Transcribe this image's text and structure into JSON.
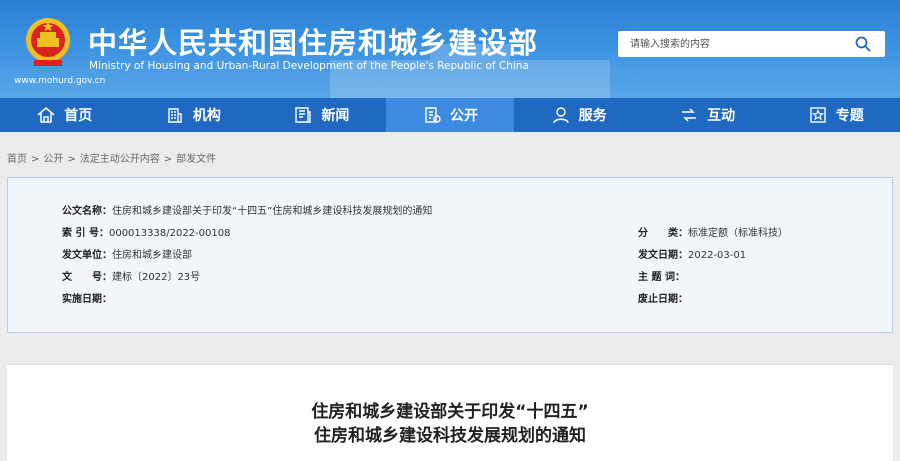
{
  "header": {
    "title": "中华人民共和国住房和城乡建设部",
    "subtitle": "Ministry of Housing and Urban-Rural Development of the People's Republic of China",
    "site_url": "www.mohurd.gov.cn",
    "search_placeholder": "请输入搜索的内容",
    "search_icon": "search-icon"
  },
  "nav": [
    {
      "label": "首页",
      "icon": "home-icon"
    },
    {
      "label": "机构",
      "icon": "building-icon"
    },
    {
      "label": "新闻",
      "icon": "news-icon"
    },
    {
      "label": "公开",
      "icon": "disclosure-icon"
    },
    {
      "label": "服务",
      "icon": "service-icon"
    },
    {
      "label": "互动",
      "icon": "interaction-icon"
    },
    {
      "label": "专题",
      "icon": "topic-icon"
    }
  ],
  "breadcrumb": [
    "首页",
    "公开",
    "法定主动公开内容",
    "部发文件"
  ],
  "breadcrumb_sep": ">",
  "info": {
    "name_label": "公文名称：",
    "name_value": "住房和城乡建设部关于印发“十四五”住房和城乡建设科技发展规划的通知",
    "index_label": "索 引 号：",
    "index_value": "000013338/2022-00108",
    "category_label": "分　　类：",
    "category_value": "标准定额（标准科技）",
    "issuer_label": "发文单位：",
    "issuer_value": "住房和城乡建设部",
    "date_label": "发文日期：",
    "date_value": "2022-03-01",
    "docno_label": "文　　号：",
    "docno_value": "建标〔2022〕23号",
    "keywords_label": "主 题 词：",
    "keywords_value": "",
    "effective_label": "实施日期：",
    "effective_value": "",
    "expire_label": "废止日期：",
    "expire_value": ""
  },
  "article": {
    "title_line1": "住房和城乡建设部关于印发“十四五”",
    "title_line2": "住房和城乡建设科技发展规划的通知"
  },
  "colors": {
    "header_blue": "#2a7fd3",
    "nav_blue": "#1f69c2",
    "nav_active": "#3d8be0",
    "info_bg": "#f1f6fb"
  }
}
